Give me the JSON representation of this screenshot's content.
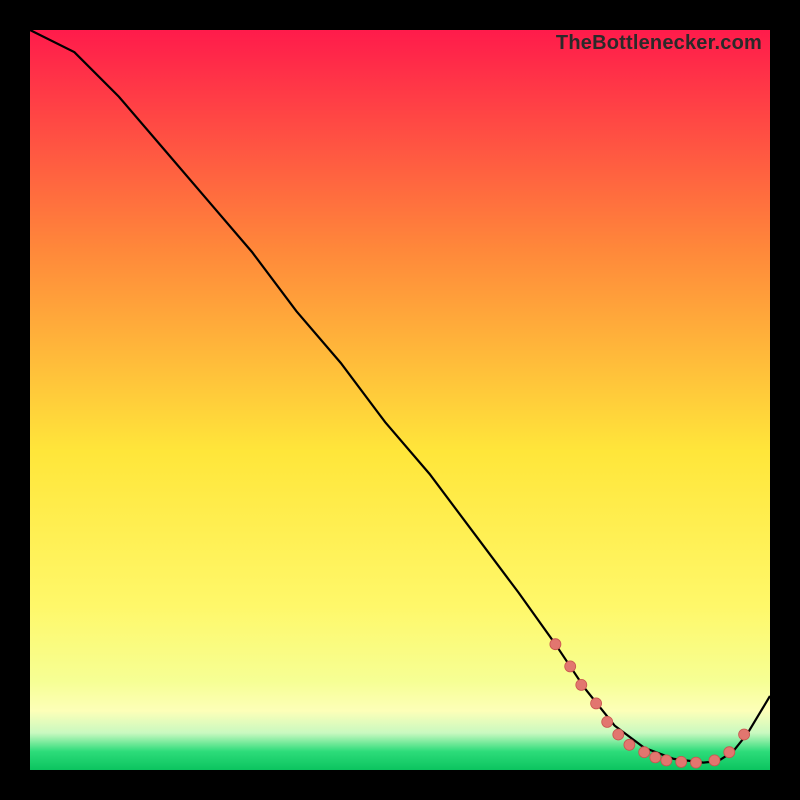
{
  "watermark": "TheBottlenecker.com",
  "colors": {
    "gradient_top": "#ff1b4b",
    "gradient_mid_upper": "#ff893a",
    "gradient_mid": "#ffe63a",
    "gradient_mid_lower": "#fff86a",
    "gradient_low": "#f6ff94",
    "gradient_yellow_pale": "#fdffb8",
    "gradient_green_pale": "#c9f9c0",
    "gradient_green": "#2ddc7a",
    "gradient_bottom": "#0bc45f",
    "curve": "#000000",
    "marker_fill": "#e2766f",
    "marker_stroke": "#c9554f"
  },
  "chart_data": {
    "type": "line",
    "title": "",
    "xlabel": "",
    "ylabel": "",
    "xlim": [
      0,
      100
    ],
    "ylim": [
      0,
      100
    ],
    "note": "Axes are unlabeled; x/y are normalized 0–100 from pixel positions (left/bottom origin).",
    "series": [
      {
        "name": "curve",
        "x": [
          0,
          6,
          12,
          18,
          24,
          30,
          36,
          42,
          48,
          54,
          60,
          66,
          71,
          75,
          79,
          83,
          87,
          91,
          93,
          95,
          97,
          100
        ],
        "y": [
          100,
          97,
          91,
          84,
          77,
          70,
          62,
          55,
          47,
          40,
          32,
          24,
          17,
          11,
          6,
          3,
          1.5,
          1,
          1.2,
          2.5,
          5,
          10
        ]
      }
    ],
    "markers": {
      "name": "highlighted-points",
      "x": [
        71,
        73,
        74.5,
        76.5,
        78,
        79.5,
        81,
        83,
        84.5,
        86,
        88,
        90,
        92.5,
        94.5,
        96.5
      ],
      "y": [
        17,
        14,
        11.5,
        9,
        6.5,
        4.8,
        3.4,
        2.4,
        1.7,
        1.3,
        1.1,
        1.0,
        1.3,
        2.4,
        4.8
      ]
    }
  }
}
